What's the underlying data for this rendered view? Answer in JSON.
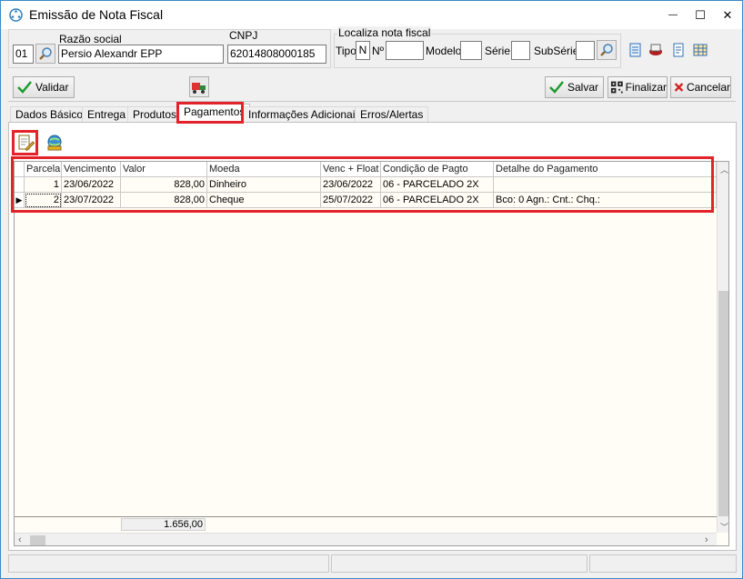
{
  "window": {
    "title": "Emissão de Nota Fiscal",
    "min_glyph": "—",
    "max_glyph": "☐",
    "close_glyph": "✕"
  },
  "header": {
    "code": "01",
    "razao_label": "Razão social",
    "razao_value": "Persio Alexandr EPP",
    "cnpj_label": "CNPJ",
    "cnpj_value": "62014808000185",
    "localiza": {
      "title": "Localiza nota fiscal",
      "tipo_label": "Tipo",
      "tipo_value": "N",
      "numero_label": "Nº",
      "numero_value": "",
      "modelo_label": "Modelo",
      "modelo_value": "",
      "serie_label": "Série",
      "serie_value": "",
      "subserie_label": "SubSérie",
      "subserie_value": ""
    }
  },
  "toolbar": {
    "validar": "Validar",
    "salvar": "Salvar",
    "finalizar": "Finalizar",
    "cancelar": "Cancelar"
  },
  "tabs": [
    {
      "label": "Dados Básicos"
    },
    {
      "label": "Entrega"
    },
    {
      "label": "Produtos"
    },
    {
      "label": "Pagamentos"
    },
    {
      "label": "Informações Adicionais"
    },
    {
      "label": "Erros/Alertas"
    }
  ],
  "active_tab": "Pagamentos",
  "grid": {
    "columns": [
      "Parcela",
      "Vencimento",
      "Valor",
      "Moeda",
      "Venc + Float",
      "Condição de Pagto",
      "Detalhe do Pagamento"
    ],
    "rows": [
      {
        "parcela": "1",
        "vencimento": "23/06/2022",
        "valor": "828,00",
        "moeda": "Dinheiro",
        "venc_float": "23/06/2022",
        "condicao": "06 - PARCELADO 2X",
        "detalhe": ""
      },
      {
        "parcela": "2",
        "vencimento": "23/07/2022",
        "valor": "828,00",
        "moeda": "Cheque",
        "venc_float": "25/07/2022",
        "condicao": "06 - PARCELADO 2X",
        "detalhe": "Bco: 0 Agn.:  Cnt.:  Chq.:"
      }
    ],
    "total_valor": "1.656,00",
    "current_row_indicator": "▶"
  },
  "colors": {
    "accent_red": "#e3222a",
    "grid_bg": "#fffdf5",
    "window_border": "#3c8ac4"
  }
}
